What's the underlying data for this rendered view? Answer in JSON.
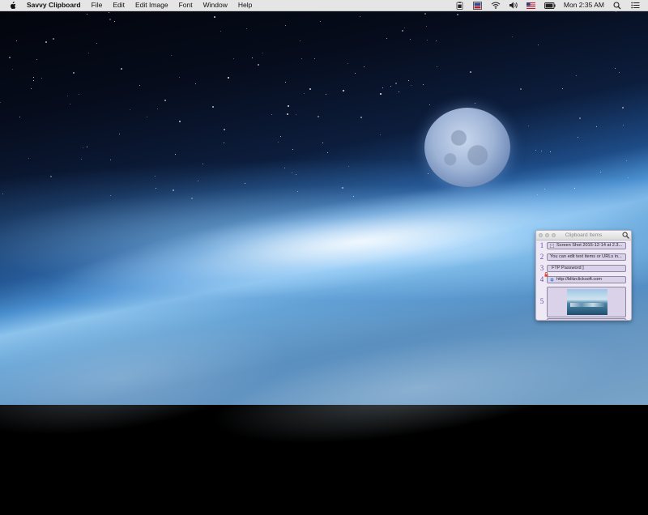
{
  "menubar": {
    "app_name": "Savvy Clipboard",
    "menus": [
      "File",
      "Edit",
      "Edit Image",
      "Font",
      "Window",
      "Help"
    ],
    "status_icons": [
      "savvy-clipboard-status-icon",
      "input-source-icon",
      "wifi-icon",
      "volume-icon",
      "flag-icon",
      "battery-icon"
    ],
    "clock": "Mon 2:35 AM",
    "right_icons": [
      "spotlight-search-icon",
      "notification-center-icon"
    ]
  },
  "panel": {
    "title": "Clipboard Items",
    "items": [
      {
        "number": "1",
        "text": "Screen Shot 2015-12-14 at 2.3...",
        "icon": "screenshot-file-icon"
      },
      {
        "number": "2",
        "text": "You can edit text items or URLs in...",
        "icon": ""
      },
      {
        "number": "3",
        "text": "FTP Password ]",
        "icon": "lock-icon"
      },
      {
        "number": "4",
        "text": "http://blitzclicksoft.com",
        "icon": "url-globe-icon"
      },
      {
        "number": "5",
        "text": "",
        "icon": "image-thumbnail"
      }
    ]
  },
  "colors": {
    "accent": "#6b4fa3",
    "row_fill": "#d9d2e8",
    "panel_bg": "#efe9f5"
  }
}
